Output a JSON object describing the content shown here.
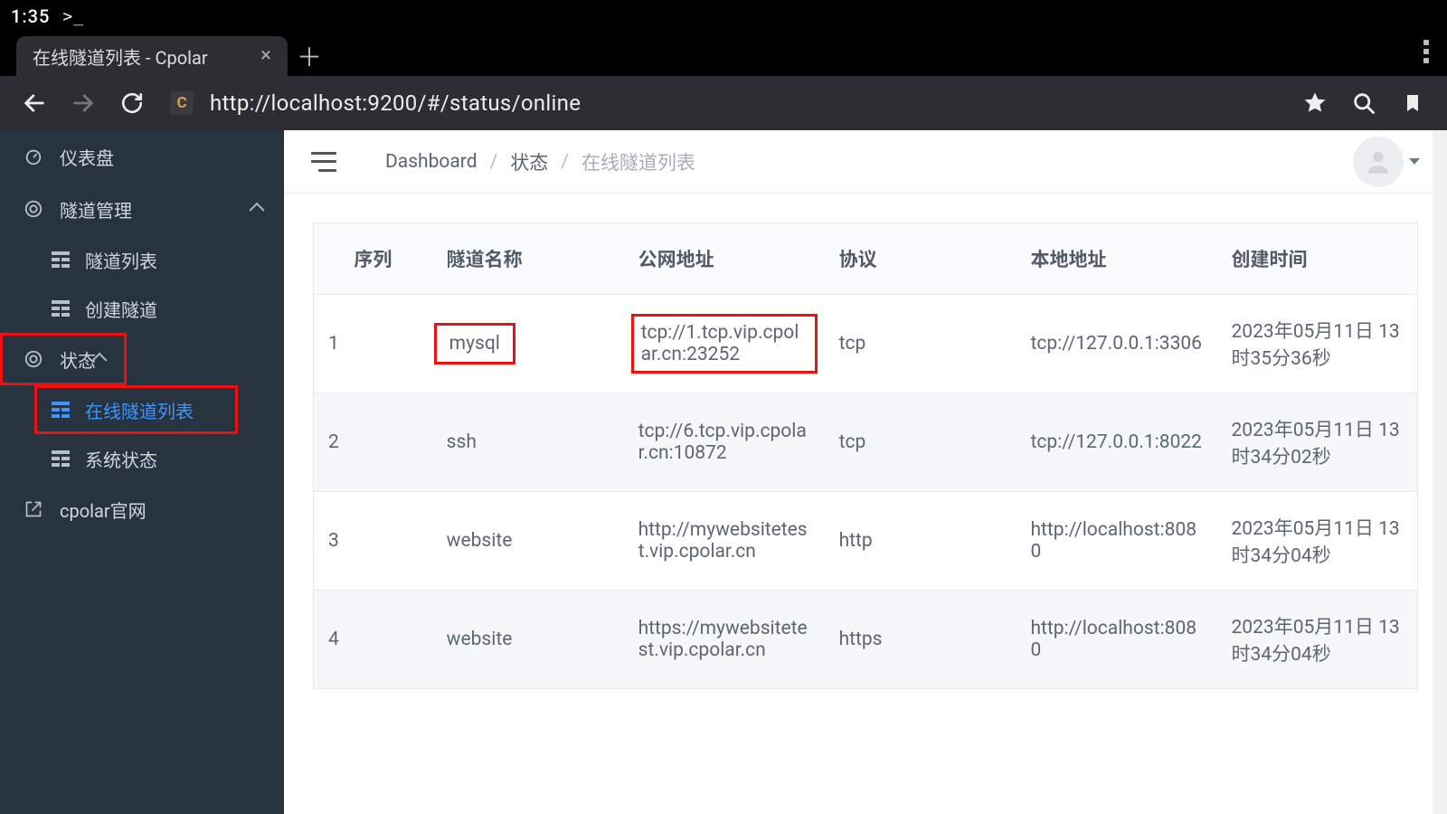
{
  "system": {
    "time": "1:35",
    "prompt": ">_"
  },
  "browser": {
    "tab_title": "在线隧道列表 - Cpolar",
    "url": "http://localhost:9200/#/status/online",
    "favicon_letter": "C"
  },
  "sidebar": {
    "dashboard": "仪表盘",
    "tunnel_mgmt": "隧道管理",
    "tunnel_list": "隧道列表",
    "create_tunnel": "创建隧道",
    "status": "状态",
    "online_list": "在线隧道列表",
    "system_status": "系统状态",
    "official_site": "cpolar官网"
  },
  "breadcrumb": {
    "dashboard": "Dashboard",
    "status": "状态",
    "online_list": "在线隧道列表"
  },
  "table": {
    "headers": {
      "index": "序列",
      "name": "隧道名称",
      "public": "公网地址",
      "proto": "协议",
      "local": "本地地址",
      "created": "创建时间"
    },
    "rows": [
      {
        "index": "1",
        "name": "mysql",
        "public": "tcp://1.tcp.vip.cpolar.cn:23252",
        "proto": "tcp",
        "local": "tcp://127.0.0.1:3306",
        "created": "2023年05月11日 13时35分36秒"
      },
      {
        "index": "2",
        "name": "ssh",
        "public": "tcp://6.tcp.vip.cpolar.cn:10872",
        "proto": "tcp",
        "local": "tcp://127.0.0.1:8022",
        "created": "2023年05月11日 13时34分02秒"
      },
      {
        "index": "3",
        "name": "website",
        "public": "http://mywebsitetest.vip.cpolar.cn",
        "proto": "http",
        "local": "http://localhost:8080",
        "created": "2023年05月11日 13时34分04秒"
      },
      {
        "index": "4",
        "name": "website",
        "public": "https://mywebsitetest.vip.cpolar.cn",
        "proto": "https",
        "local": "http://localhost:8080",
        "created": "2023年05月11日 13时34分04秒"
      }
    ]
  }
}
